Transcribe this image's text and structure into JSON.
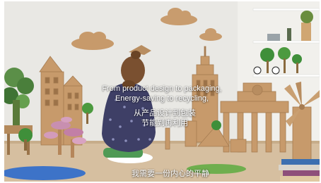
{
  "video": {
    "caption_en": [
      "From product design to packaging,",
      "Energy-saving to recycling,"
    ],
    "caption_zh": [
      "从产品设计到包装",
      "节能到再利用"
    ],
    "subtitle": "我需要一份内心的平静"
  },
  "colors": {
    "wall": "#e9e8e4",
    "floor": "#d6bfa0",
    "cardboard": "#c79a6b",
    "sweater": "#3e3f66",
    "hair": "#7a5030",
    "pink": "#c88fb0",
    "green": "#3f8f3a"
  }
}
